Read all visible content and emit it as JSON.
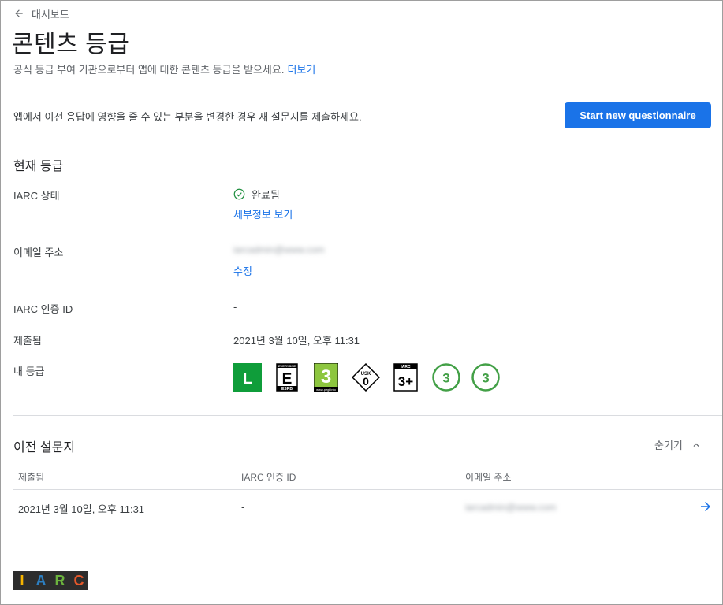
{
  "header": {
    "back_label": "대시보드",
    "title": "콘텐츠 등급",
    "subtitle": "공식 등급 부여 기관으로부터 앱에 대한 콘텐츠 등급을 받으세요.",
    "learn_more": "더보기"
  },
  "notice": {
    "text": "앱에서 이전 응답에 영향을 줄 수 있는 부분을 변경한 경우 새 설문지를 제출하세요.",
    "button_label": "Start new questionnaire"
  },
  "current_rating": {
    "section_title": "현재 등급",
    "iarc_status_label": "IARC 상태",
    "iarc_status_value": "완료됨",
    "view_details": "세부정보 보기",
    "email_label": "이메일 주소",
    "email_value": "iarcadmin@www.com",
    "edit_label": "수정",
    "cert_id_label": "IARC 인증 ID",
    "cert_id_value": "-",
    "submitted_label": "제출됨",
    "submitted_value": "2021년 3월 10일, 오후 11:31",
    "my_ratings_label": "내 등급",
    "badges": [
      {
        "icon": "classind-l-icon",
        "text": "L",
        "color": "#0f9d3a"
      },
      {
        "icon": "esrb-e-icon",
        "text": "E",
        "sub": "ESRB",
        "top": "EVERYONE"
      },
      {
        "icon": "pegi-3-icon",
        "text": "3",
        "sub": "www.pegi.info",
        "color": "#8dc63f"
      },
      {
        "icon": "usk-0-icon",
        "text": "0",
        "top": "USK"
      },
      {
        "icon": "iarc-3plus-icon",
        "text": "3+",
        "top": "IARC"
      },
      {
        "icon": "generic-3-circle-icon",
        "text": "3",
        "color": "#43a047"
      },
      {
        "icon": "generic-3-circle-icon",
        "text": "3",
        "color": "#43a047"
      }
    ]
  },
  "previous": {
    "section_title": "이전 설문지",
    "hide_label": "숨기기",
    "columns": [
      "제출됨",
      "IARC 인증 ID",
      "이메일 주소"
    ],
    "rows": [
      {
        "submitted": "2021년 3월 10일, 오후 11:31",
        "cert_id": "-",
        "email": "iarcadmin@www.com"
      }
    ]
  },
  "footer": {
    "logo_letters": [
      "I",
      "A",
      "R",
      "C"
    ],
    "logo_colors": [
      "#f6b400",
      "#2d7fc1",
      "#6cb33e",
      "#e6582a"
    ]
  },
  "colors": {
    "accent": "#1a73e8",
    "success": "#1e8e3e"
  }
}
